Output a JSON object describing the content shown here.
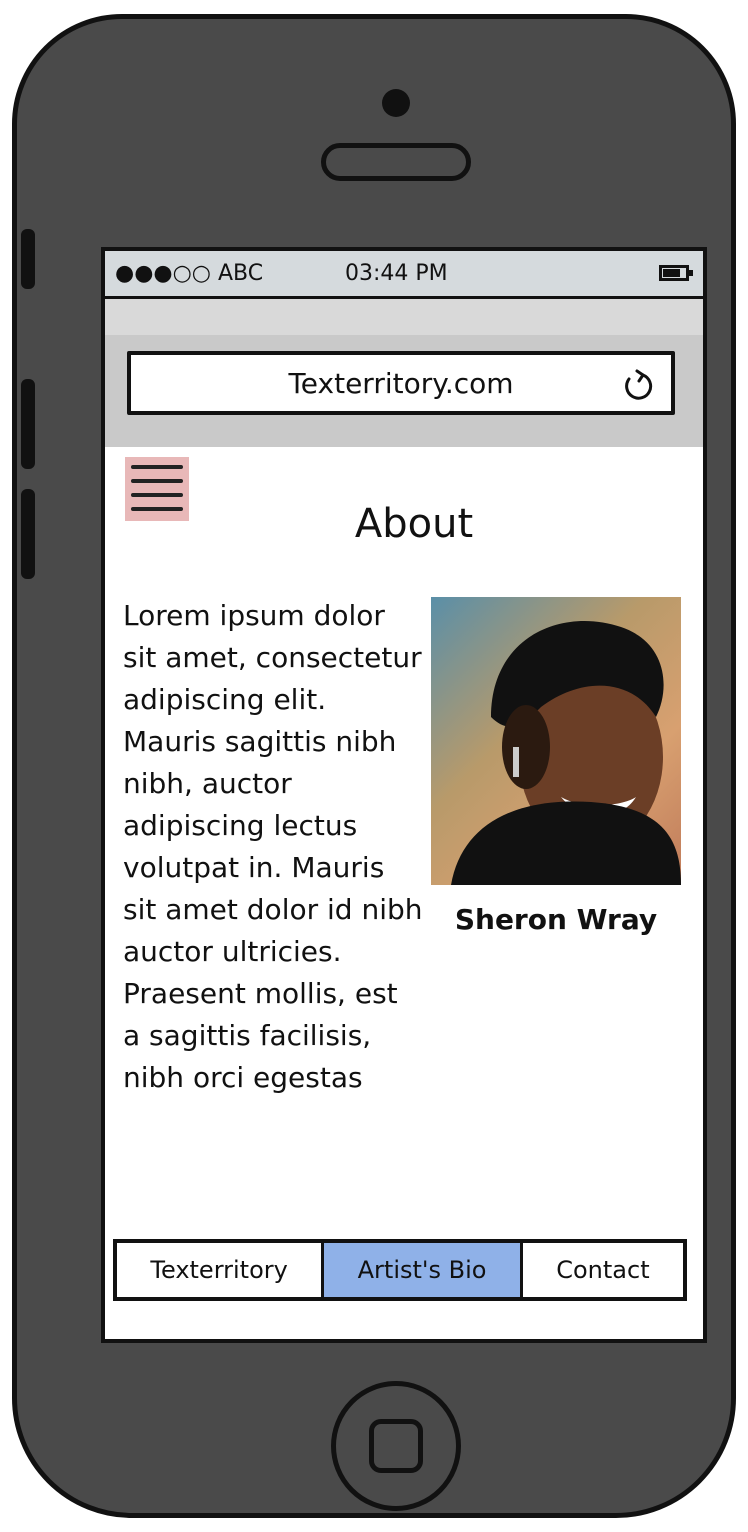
{
  "status_bar": {
    "carrier": "●●●○○ ABC",
    "time": "03:44 PM",
    "battery_icon": "battery-icon"
  },
  "browser": {
    "url": "Texterritory.com",
    "reload_icon": "reload-icon"
  },
  "menu_icon": "hamburger-menu-icon",
  "page": {
    "title": "About",
    "bio_text": "Lorem ipsum dolor sit amet, consectetur adipiscing elit. Mauris sagittis nibh nibh, auctor adipiscing lectus volutpat in. Mauris sit amet dolor id nibh auctor ultricies. Praesent mollis, est a sagittis facilisis, nibh orci egestas",
    "artist_name": "Sheron Wray"
  },
  "tabs": [
    {
      "label": "Texterritory",
      "active": false
    },
    {
      "label": "Artist's Bio",
      "active": true
    },
    {
      "label": "Contact",
      "active": false
    }
  ],
  "colors": {
    "active_tab": "#8fb1e8",
    "menu_icon_bg": "#e8b8b8",
    "phone_body": "#4a4a4a"
  }
}
